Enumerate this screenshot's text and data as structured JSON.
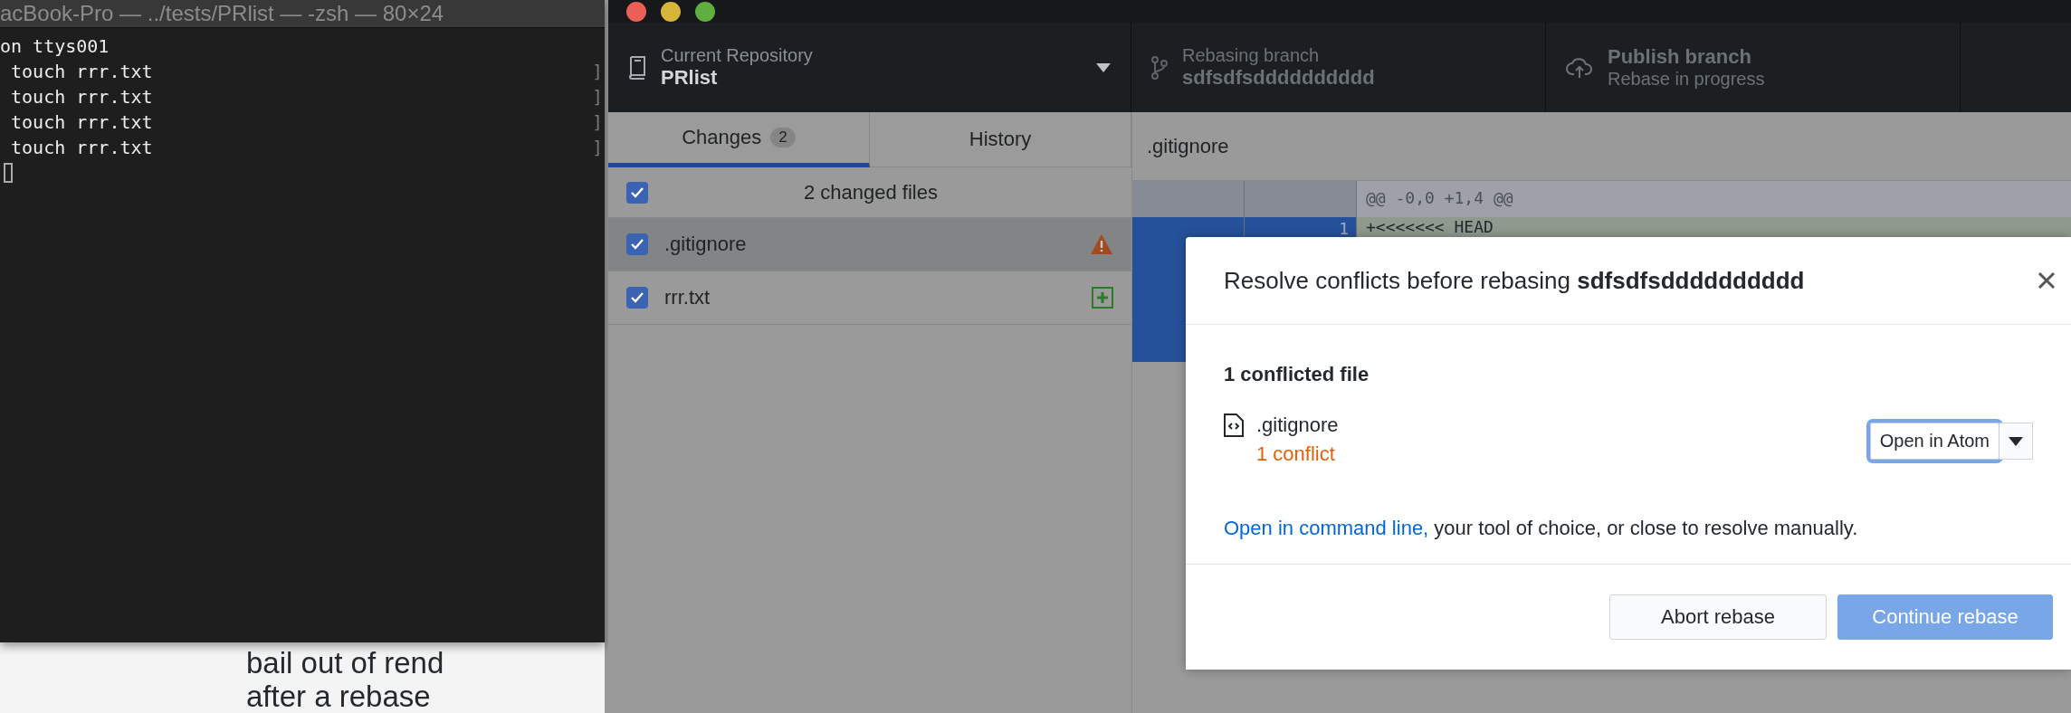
{
  "terminal": {
    "title": "acBook-Pro — ../tests/PRlist — -zsh — 80×24",
    "lines": [
      {
        "text": "on ttys001"
      },
      {
        "text": " touch rrr.txt",
        "right": "]"
      },
      {
        "text": " touch rrr.txt",
        "right": "]"
      },
      {
        "text": " touch rrr.txt",
        "right": "]"
      },
      {
        "text": " touch rrr.txt",
        "right": "]"
      }
    ]
  },
  "background_page": {
    "lines": [
      "bail out of rend",
      "after a rebase"
    ]
  },
  "app": {
    "toolbar": [
      {
        "kind": "repository",
        "label": "Current Repository",
        "value": "PRlist",
        "disabled": false
      },
      {
        "kind": "branch",
        "label": "Rebasing branch",
        "value": "sdfsdfsdddddddddd",
        "disabled": true
      },
      {
        "kind": "publish",
        "label": "Publish branch",
        "value": "Rebase in progress",
        "disabled": true
      }
    ],
    "tabs": [
      {
        "label": "Changes",
        "count": "2",
        "selected": true
      },
      {
        "label": "History",
        "selected": false
      }
    ],
    "changes": {
      "all_checked": true,
      "summary": "2 changed files",
      "files": [
        {
          "name": ".gitignore",
          "checked": true,
          "selected": true,
          "kind": "conflicted"
        },
        {
          "name": "rrr.txt",
          "checked": true,
          "selected": false,
          "kind": "new"
        }
      ]
    },
    "diff": {
      "file": ".gitignore",
      "hunk": "@@ -0,0 +1,4 @@",
      "lines": [
        {
          "number": "1",
          "text": "+<<<<<<< HEAD",
          "selected": true
        }
      ]
    }
  },
  "dialog": {
    "title": "Resolve conflicts before rebasing **sdfsdfsdddddddddd**",
    "heading": "1 conflicted file",
    "files": [
      {
        "name": ".gitignore",
        "conflicts": "1 conflict",
        "button": "Open in Atom"
      }
    ],
    "link": "Open in command line,",
    "note": "your tool of choice, or close to resolve manually.",
    "buttons": [
      {
        "label": "Abort rebase",
        "kind": "secondary",
        "disabled": false
      },
      {
        "label": "Continue rebase",
        "kind": "primary",
        "disabled": true
      }
    ]
  }
}
